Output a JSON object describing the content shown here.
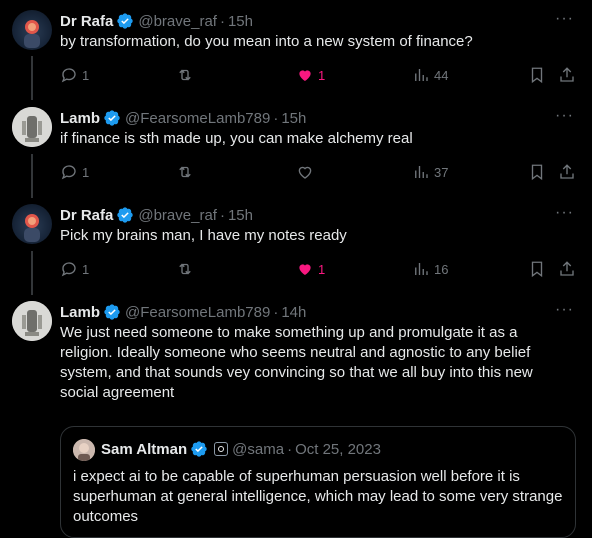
{
  "tweets": [
    {
      "name": "Dr Rafa",
      "handle": "@brave_raf",
      "separator": "·",
      "time": "15h",
      "text": "by transformation, do you mean into a new system of finance?",
      "replies": "1",
      "retweets": "",
      "likes": "1",
      "liked": true,
      "views": "44"
    },
    {
      "name": "Lamb",
      "handle": "@FearsomeLamb789",
      "separator": "·",
      "time": "15h",
      "text": "if finance is sth made up, you can make alchemy real",
      "replies": "1",
      "retweets": "",
      "likes": "",
      "liked": false,
      "views": "37"
    },
    {
      "name": "Dr Rafa",
      "handle": "@brave_raf",
      "separator": "·",
      "time": "15h",
      "text": "Pick my brains man, I have my notes ready",
      "replies": "1",
      "retweets": "",
      "likes": "1",
      "liked": true,
      "views": "16"
    },
    {
      "name": "Lamb",
      "handle": "@FearsomeLamb789",
      "separator": "·",
      "time": "14h",
      "text": "We just need someone to make something up and promulgate it as a religion. Ideally someone who seems neutral and agnostic to any belief system, and that sounds vey convincing so that we all buy into this new social agreement"
    }
  ],
  "quote": {
    "name": "Sam Altman",
    "handle": "@sama",
    "separator": "·",
    "time": "Oct 25, 2023",
    "text": "i expect ai to be capable of superhuman persuasion well before it is superhuman at general intelligence, which may lead to some very strange outcomes"
  },
  "more_label": "···",
  "icons": {
    "verified": "verified-badge-icon",
    "reply": "reply-icon",
    "retweet": "retweet-icon",
    "like": "heart-icon",
    "views": "views-icon",
    "bookmark": "bookmark-icon",
    "share": "share-icon",
    "more": "more-icon"
  },
  "colors": {
    "background": "#000000",
    "text": "#e7e9ea",
    "muted": "#71767b",
    "verified": "#1d9bf0",
    "like": "#f91880",
    "border": "#2f3336"
  }
}
